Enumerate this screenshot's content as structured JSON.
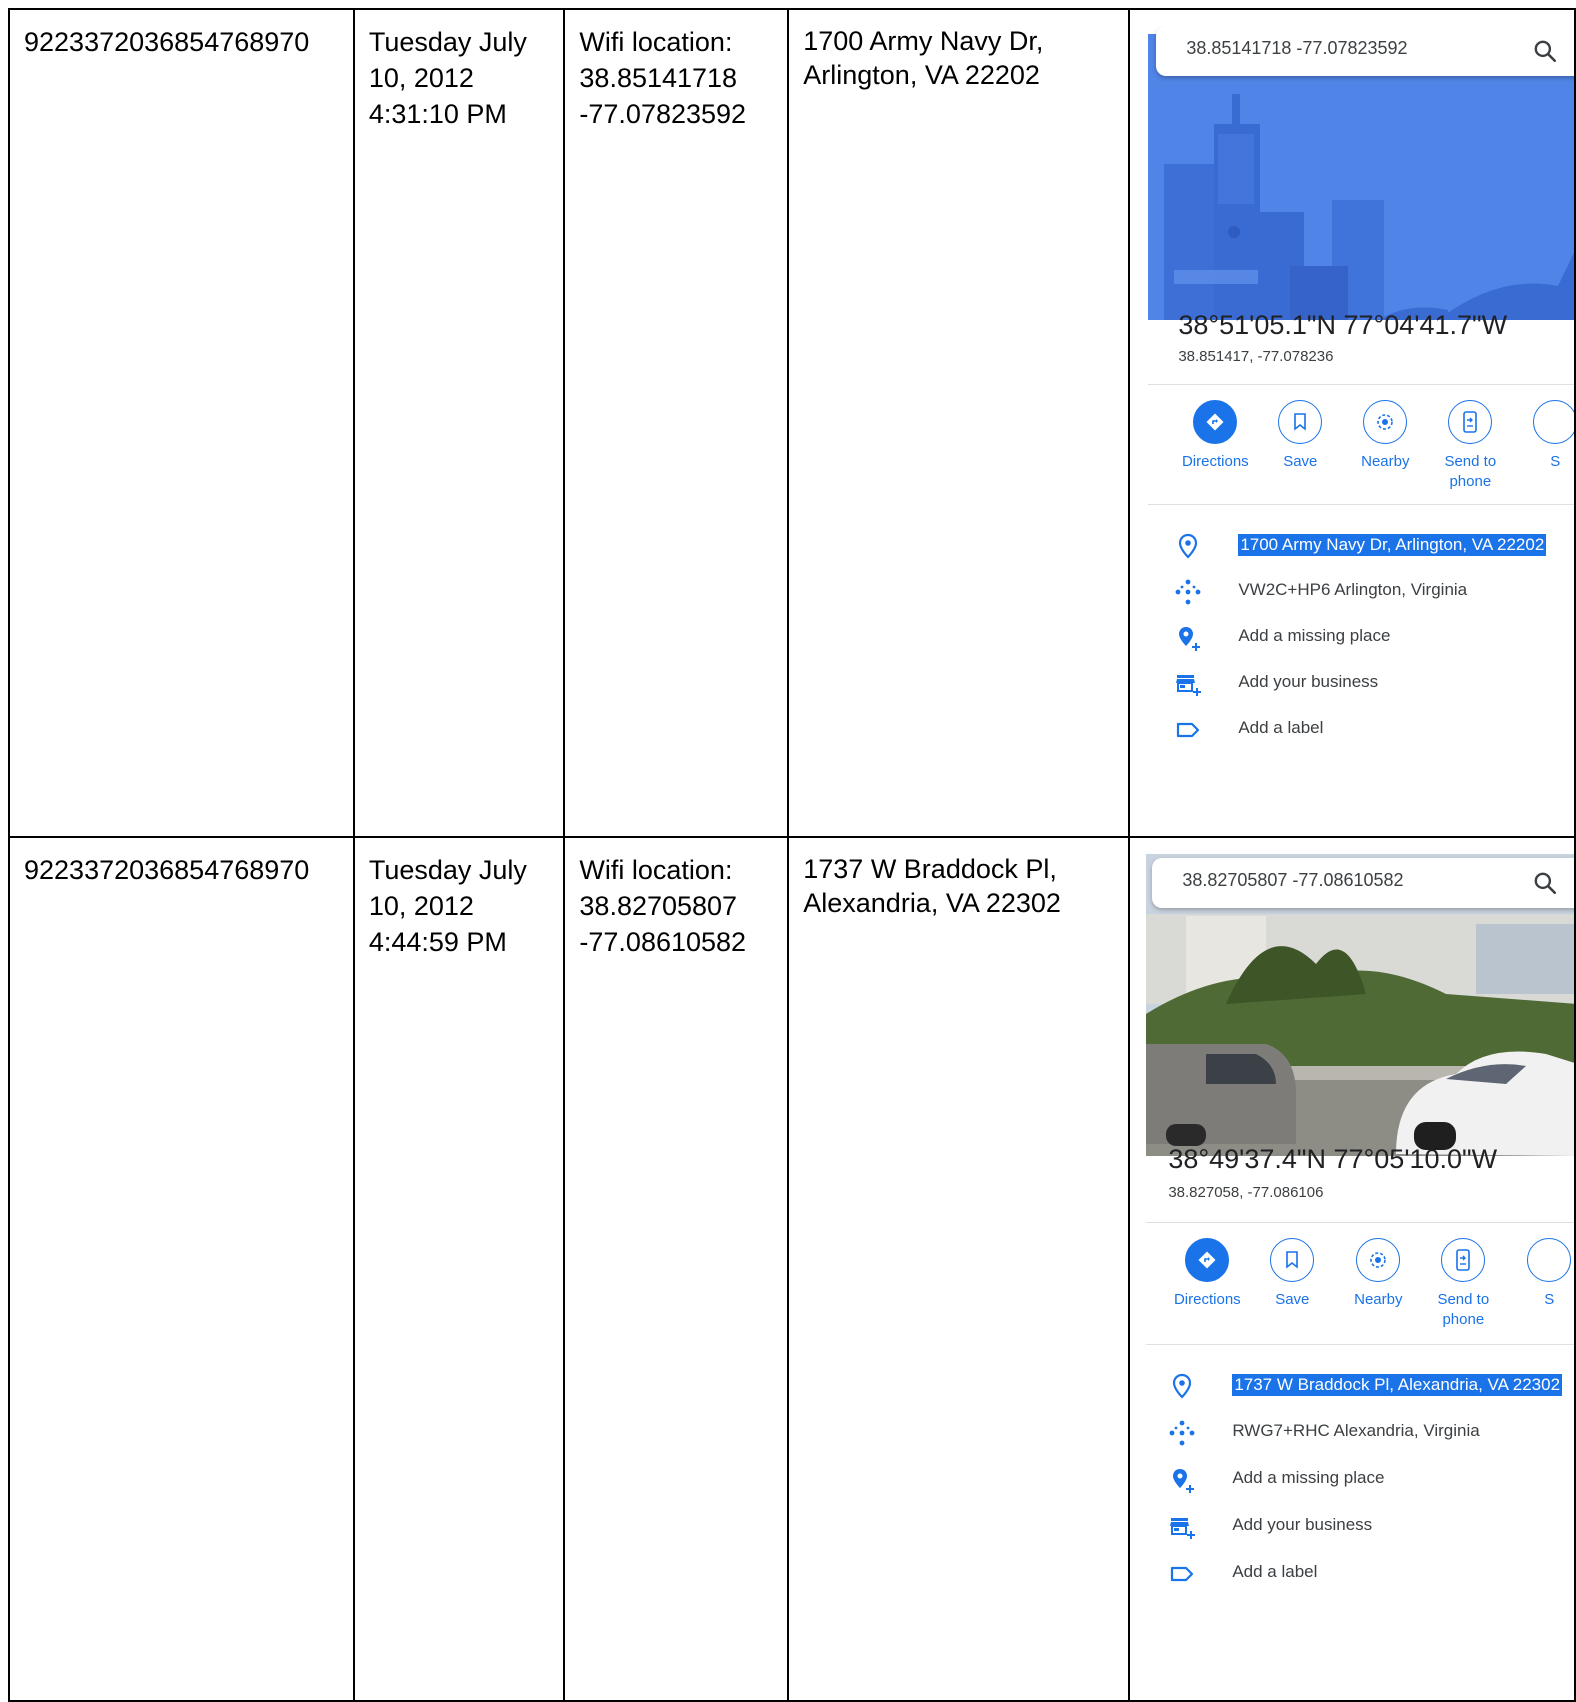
{
  "rows": [
    {
      "id": "9223372036854768970",
      "datetime": [
        "Tuesday July",
        "10, 2012",
        "4:31:10 PM"
      ],
      "wifi": [
        "Wifi location:",
        "38.85141718",
        "-77.07823592"
      ],
      "address": [
        "1700 Army Navy Dr,",
        "Arlington, VA 22202"
      ],
      "map": {
        "search_query": "38.85141718 -77.07823592",
        "search_icon": "search-icon",
        "hero": "city-illustration",
        "coord_dms": "38°51'05.1\"N 77°04'41.7\"W",
        "coord_decimal": "38.851417, -77.078236",
        "actions": [
          {
            "label": "Directions",
            "icon": "directions-icon"
          },
          {
            "label": "Save",
            "icon": "bookmark-icon"
          },
          {
            "label": "Nearby",
            "icon": "nearby-icon"
          },
          {
            "label": "Send to phone",
            "icon": "send-to-phone-icon"
          },
          {
            "label": "S",
            "icon": "share-icon"
          }
        ],
        "info": [
          {
            "text": "1700 Army Navy Dr, Arlington, VA 22202",
            "icon": "location-pin-icon",
            "highlighted": true
          },
          {
            "text": "VW2C+HP6 Arlington, Virginia",
            "icon": "plus-code-icon",
            "highlighted": false
          },
          {
            "text": "Add a missing place",
            "icon": "add-place-icon",
            "highlighted": false
          },
          {
            "text": "Add your business",
            "icon": "add-business-icon",
            "highlighted": false
          },
          {
            "text": "Add a label",
            "icon": "label-icon",
            "highlighted": false
          }
        ]
      }
    },
    {
      "id": "9223372036854768970",
      "datetime": [
        "Tuesday July",
        "10, 2012",
        "4:44:59 PM"
      ],
      "wifi": [
        "Wifi location:",
        "38.82705807",
        "-77.08610582"
      ],
      "address": [
        "1737 W Braddock Pl,",
        "Alexandria, VA 22302"
      ],
      "map": {
        "search_query": "38.82705807 -77.08610582",
        "search_icon": "search-icon",
        "hero": "street-view-photo",
        "coord_dms": "38°49'37.4\"N 77°05'10.0\"W",
        "coord_decimal": "38.827058, -77.086106",
        "actions": [
          {
            "label": "Directions",
            "icon": "directions-icon"
          },
          {
            "label": "Save",
            "icon": "bookmark-icon"
          },
          {
            "label": "Nearby",
            "icon": "nearby-icon"
          },
          {
            "label": "Send to phone",
            "icon": "send-to-phone-icon"
          },
          {
            "label": "S",
            "icon": "share-icon"
          }
        ],
        "info": [
          {
            "text": "1737 W Braddock Pl, Alexandria, VA 22302",
            "icon": "location-pin-icon",
            "highlighted": true
          },
          {
            "text": "RWG7+RHC Alexandria, Virginia",
            "icon": "plus-code-icon",
            "highlighted": false
          },
          {
            "text": "Add a missing place",
            "icon": "add-place-icon",
            "highlighted": false
          },
          {
            "text": "Add your business",
            "icon": "add-business-icon",
            "highlighted": false
          },
          {
            "text": "Add a label",
            "icon": "label-icon",
            "highlighted": false
          }
        ]
      }
    }
  ],
  "colors": {
    "accent": "#1a73e8",
    "hero_blue": "#4a7fe0",
    "text": "#3c4043",
    "divider": "#e0e0e0"
  }
}
